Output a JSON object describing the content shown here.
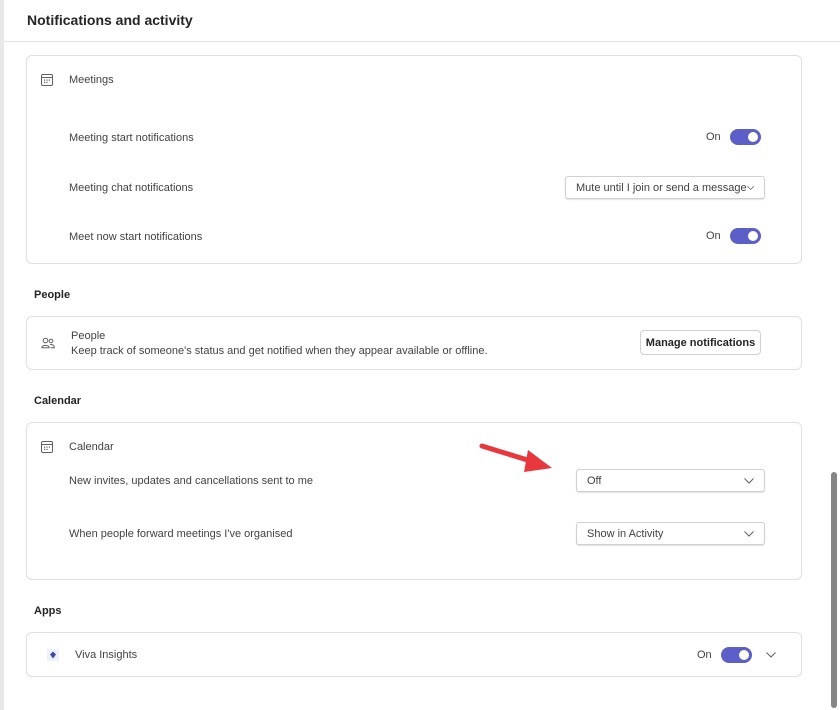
{
  "header": {
    "title": "Notifications and activity"
  },
  "meetings": {
    "card_title": "Meetings",
    "icon": "calendar-icon",
    "rows": [
      {
        "label": "Meeting start notifications",
        "type": "toggle",
        "state_text": "On",
        "on": true
      },
      {
        "label": "Meeting chat notifications",
        "type": "dropdown",
        "value": "Mute until I join or send a message"
      },
      {
        "label": "Meet now start notifications",
        "type": "toggle",
        "state_text": "On",
        "on": true
      }
    ]
  },
  "people": {
    "section_label": "People",
    "card_title": "People",
    "description": "Keep track of someone's status and get notified when they appear available or offline.",
    "icon": "people-icon",
    "button_label": "Manage notifications"
  },
  "calendar": {
    "section_label": "Calendar",
    "card_title": "Calendar",
    "icon": "calendar-icon",
    "rows": [
      {
        "label": "New invites, updates and cancellations sent to me",
        "type": "dropdown",
        "value": "Off"
      },
      {
        "label": "When people forward meetings I've organised",
        "type": "dropdown",
        "value": "Show in Activity"
      }
    ]
  },
  "apps": {
    "section_label": "Apps",
    "items": [
      {
        "name": "Viva Insights",
        "icon": "viva-insights-icon",
        "state_text": "On",
        "on": true
      }
    ]
  },
  "annotation": {
    "type": "arrow",
    "color": "#e8383d",
    "points_to": "calendar-new-invites-dropdown"
  },
  "colors": {
    "accent": "#5b5fc7"
  }
}
